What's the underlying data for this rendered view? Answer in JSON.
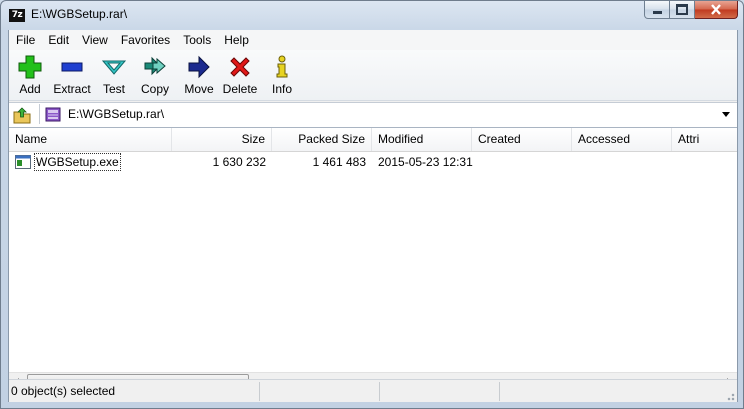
{
  "window": {
    "title": "E:\\WGBSetup.rar\\",
    "app_icon_text": "7z",
    "controls": [
      "minimize-icon",
      "maximize-icon",
      "close-icon"
    ]
  },
  "menu": [
    "File",
    "Edit",
    "View",
    "Favorites",
    "Tools",
    "Help"
  ],
  "toolbar": [
    {
      "label": "Add",
      "icon": "plus-icon",
      "color": "#22c01a"
    },
    {
      "label": "Extract",
      "icon": "minus-icon",
      "color": "#1f3fd0"
    },
    {
      "label": "Test",
      "icon": "chevron-down-icon",
      "color": "#33c6c6"
    },
    {
      "label": "Copy",
      "icon": "double-arrow-right-icon",
      "color": "#1a8a78"
    },
    {
      "label": "Move",
      "icon": "arrow-right-icon",
      "color": "#1b2a8f"
    },
    {
      "label": "Delete",
      "icon": "x-icon",
      "color": "#e01818"
    },
    {
      "label": "Info",
      "icon": "info-icon",
      "color": "#e7d321"
    }
  ],
  "address": {
    "path": "E:\\WGBSetup.rar\\",
    "up_icon": "folder-up-icon",
    "archive_icon": "archive-icon"
  },
  "columns": [
    "Name",
    "Size",
    "Packed Size",
    "Modified",
    "Created",
    "Accessed",
    "Attri"
  ],
  "rows": [
    {
      "icon": "exe-file-icon",
      "name": "WGBSetup.exe",
      "size": "1 630 232",
      "packed_size": "1 461 483",
      "modified": "2015-05-23 12:31",
      "created": "",
      "accessed": ""
    }
  ],
  "status": {
    "selection": "0 object(s) selected",
    "pane2": "",
    "pane3": ""
  }
}
